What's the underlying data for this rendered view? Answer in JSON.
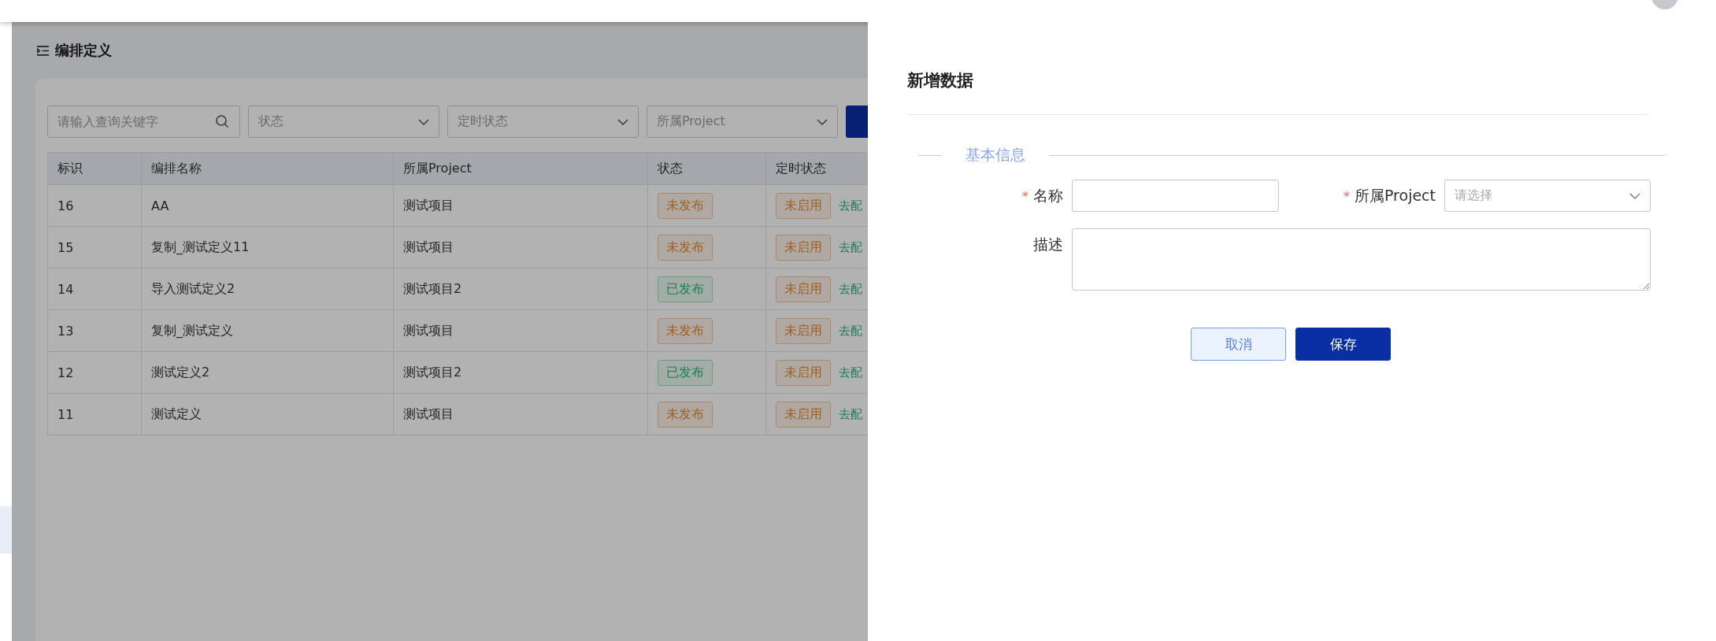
{
  "page": {
    "title": "编排定义"
  },
  "filters": {
    "search": {
      "placeholder": "请输入查询关键字"
    },
    "selects": [
      {
        "placeholder": "状态"
      },
      {
        "placeholder": "定时状态"
      },
      {
        "placeholder": "所属Project"
      }
    ]
  },
  "table": {
    "columns": [
      "标识",
      "编排名称",
      "所属Project",
      "状态",
      "定时状态"
    ],
    "rows": [
      {
        "id": "16",
        "name": "AA",
        "project": "测试项目",
        "status": {
          "text": "未发布",
          "kind": "warning"
        },
        "timer": {
          "text": "未启用",
          "kind": "warning"
        },
        "action": "去配"
      },
      {
        "id": "15",
        "name": "复制_测试定义11",
        "project": "测试项目",
        "status": {
          "text": "未发布",
          "kind": "warning"
        },
        "timer": {
          "text": "未启用",
          "kind": "warning"
        },
        "action": "去配"
      },
      {
        "id": "14",
        "name": "导入测试定义2",
        "project": "测试项目2",
        "status": {
          "text": "已发布",
          "kind": "success"
        },
        "timer": {
          "text": "未启用",
          "kind": "warning"
        },
        "action": "去配"
      },
      {
        "id": "13",
        "name": "复制_测试定义",
        "project": "测试项目",
        "status": {
          "text": "未发布",
          "kind": "warning"
        },
        "timer": {
          "text": "未启用",
          "kind": "warning"
        },
        "action": "去配"
      },
      {
        "id": "12",
        "name": "测试定义2",
        "project": "测试项目2",
        "status": {
          "text": "已发布",
          "kind": "success"
        },
        "timer": {
          "text": "未启用",
          "kind": "warning"
        },
        "action": "去配"
      },
      {
        "id": "11",
        "name": "测试定义",
        "project": "测试项目",
        "status": {
          "text": "未发布",
          "kind": "warning"
        },
        "timer": {
          "text": "未启用",
          "kind": "warning"
        },
        "action": "去配"
      }
    ]
  },
  "drawer": {
    "title": "新增数据",
    "section": "基本信息",
    "fields": [
      {
        "label": "名称",
        "marker": "*",
        "kind": "input"
      },
      {
        "label": "所属Project",
        "marker": "*",
        "kind": "select",
        "placeholder": "请选择"
      },
      {
        "label": "描述",
        "kind": "textarea"
      }
    ],
    "buttons": [
      {
        "label": "取消",
        "kind": "secondary"
      },
      {
        "label": "保存",
        "kind": "primary"
      }
    ]
  }
}
